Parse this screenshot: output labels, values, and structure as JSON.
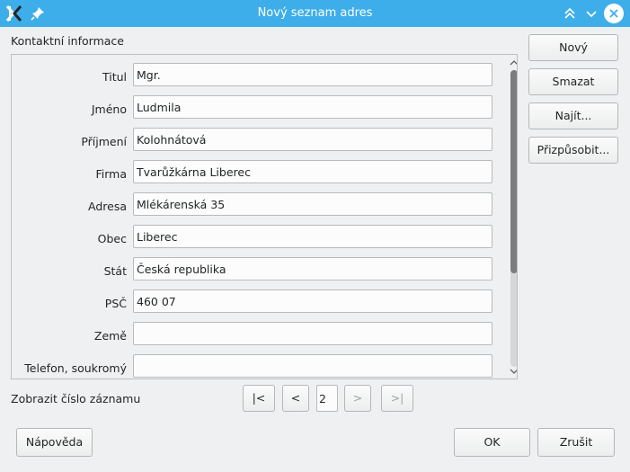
{
  "window": {
    "title": "Nový seznam adres"
  },
  "section": {
    "label": "Kontaktní informace"
  },
  "fields": [
    {
      "label": "Titul",
      "value": "Mgr."
    },
    {
      "label": "Jméno",
      "value": "Ludmila"
    },
    {
      "label": "Příjmení",
      "value": "Kolohnátová"
    },
    {
      "label": "Firma",
      "value": "Tvarůžkárna Liberec"
    },
    {
      "label": "Adresa",
      "value": "Mlékárenská 35"
    },
    {
      "label": "Obec",
      "value": "Liberec"
    },
    {
      "label": "Stát",
      "value": "Česká republika"
    },
    {
      "label": "PSČ",
      "value": "460 07"
    },
    {
      "label": "Země",
      "value": ""
    },
    {
      "label": "Telefon, soukromý",
      "value": ""
    }
  ],
  "side_buttons": {
    "new": "Nový",
    "delete": "Smazat",
    "find": "Najít...",
    "customize": "Přizpůsobit..."
  },
  "record_nav": {
    "label": "Zobrazit číslo záznamu",
    "first": "|<",
    "prev": "<",
    "current": "2",
    "next": ">",
    "last": ">|"
  },
  "bottom_buttons": {
    "help": "Nápověda",
    "ok": "OK",
    "cancel": "Zrušit"
  },
  "icons": {
    "app": "kde-app-icon",
    "pin": "pin-icon",
    "keep_above": "keep-above-icon",
    "minimize": "minimize-icon",
    "close": "close-icon"
  },
  "colors": {
    "titlebar": "#3daee9",
    "window_bg": "#eff0f1",
    "scroll_thumb": "#7a7c7e"
  }
}
